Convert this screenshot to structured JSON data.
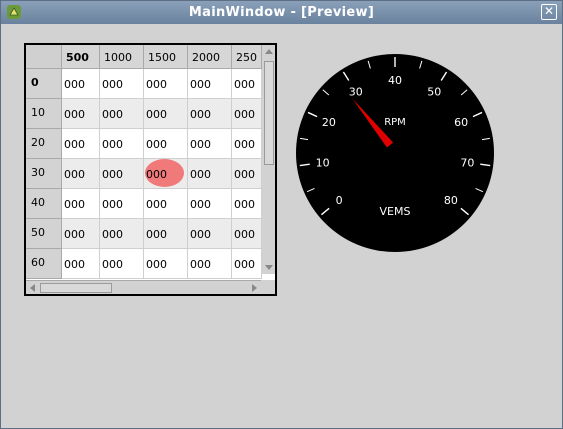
{
  "window": {
    "title": "MainWindow - [Preview]",
    "close_label": "✕"
  },
  "table": {
    "columns": [
      "500",
      "1000",
      "1500",
      "2000",
      "250"
    ],
    "rows": [
      {
        "header": "0",
        "cells": [
          "000",
          "000",
          "000",
          "000",
          "000"
        ]
      },
      {
        "header": "10",
        "cells": [
          "000",
          "000",
          "000",
          "000",
          "000"
        ]
      },
      {
        "header": "20",
        "cells": [
          "000",
          "000",
          "000",
          "000",
          "000"
        ]
      },
      {
        "header": "30",
        "cells": [
          "000",
          "000",
          "000",
          "000",
          "000"
        ]
      },
      {
        "header": "40",
        "cells": [
          "000",
          "000",
          "000",
          "000",
          "000"
        ]
      },
      {
        "header": "50",
        "cells": [
          "000",
          "000",
          "000",
          "000",
          "000"
        ]
      },
      {
        "header": "60",
        "cells": [
          "000",
          "000",
          "000",
          "000",
          "000"
        ]
      }
    ],
    "current_row": "30",
    "current_column": "1500"
  },
  "gauge": {
    "label_unit": "RPM",
    "label_brand": "VEMS",
    "scale_labels": [
      "0",
      "10",
      "20",
      "30",
      "40",
      "50",
      "60",
      "70",
      "80"
    ],
    "min": 0,
    "max": 80,
    "value": 28,
    "needle_color": "#e00000",
    "face_color": "#000000",
    "tick_color": "#ffffff"
  }
}
